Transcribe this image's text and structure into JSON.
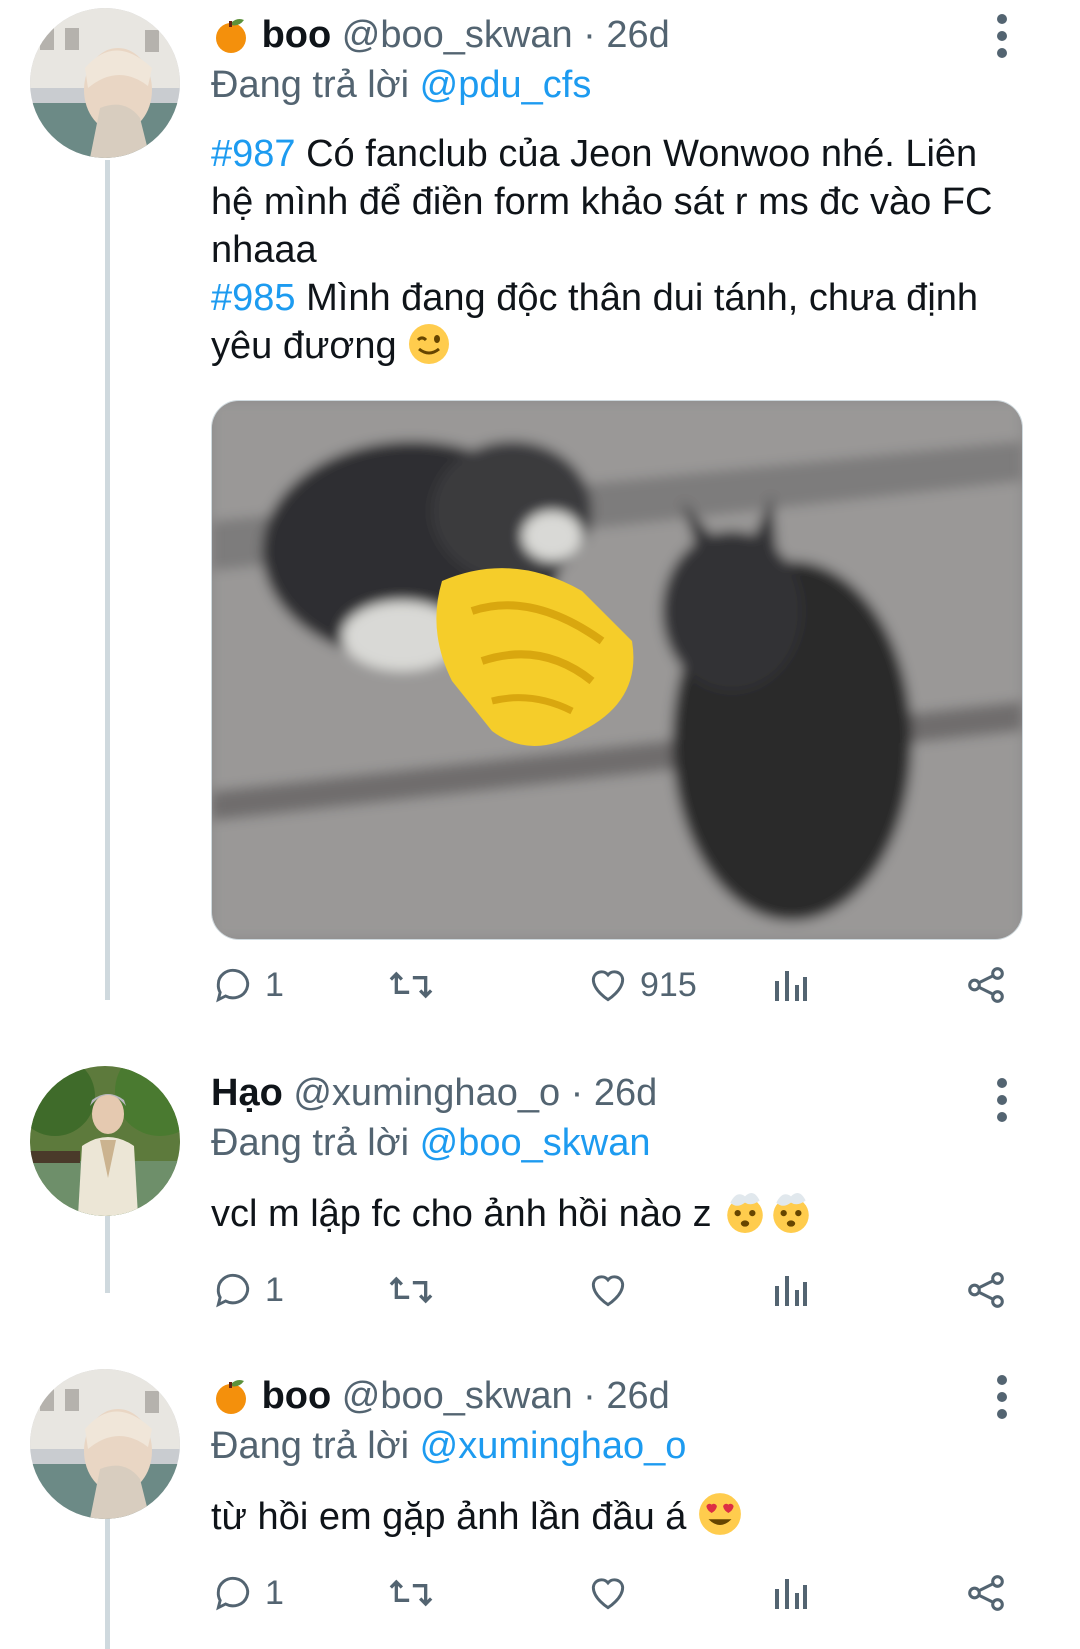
{
  "tweets": [
    {
      "name_prefix_icon": "orange-emoji",
      "name": "boo",
      "handle": "@boo_skwan",
      "separator": "·",
      "time": "26d",
      "replying_to_prefix": "Đang trả lời ",
      "replying_to": "@pdu_cfs",
      "body": [
        {
          "hashtag": "#987",
          "text": " Có fanclub của Jeon Wonwoo nhé. Liên hệ mình để điền form khảo sát r ms đc vào FC nhaaa"
        },
        {
          "hashtag": "#985",
          "text": " Mình đang độc thân dui tánh, chưa định yêu đương"
        }
      ],
      "body_emoji": "winking-face-emoji",
      "has_media": true,
      "media_description_icon": "cats-handshake-image",
      "counts": {
        "reply": "1",
        "retweet": "",
        "like": "915"
      }
    },
    {
      "name": "Hạo",
      "handle": "@xuminghao_o",
      "separator": "·",
      "time": "26d",
      "replying_to_prefix": "Đang trả lời ",
      "replying_to": "@boo_skwan",
      "body_text": "vcl m lập fc cho ảnh hồi nào z",
      "body_emoji": "exploding-head-emoji",
      "counts": {
        "reply": "1",
        "retweet": "",
        "like": ""
      }
    },
    {
      "name_prefix_icon": "orange-emoji",
      "name": "boo",
      "handle": "@boo_skwan",
      "separator": "·",
      "time": "26d",
      "replying_to_prefix": "Đang trả lời ",
      "replying_to": "@xuminghao_o",
      "body_text": "từ hồi em gặp ảnh lần đầu á",
      "body_emoji": "heart-eyes-emoji",
      "counts": {
        "reply": "1",
        "retweet": "",
        "like": ""
      }
    }
  ],
  "colors": {
    "link": "#1d9bf0",
    "secondary": "#536471",
    "thread": "#cfd9de"
  }
}
